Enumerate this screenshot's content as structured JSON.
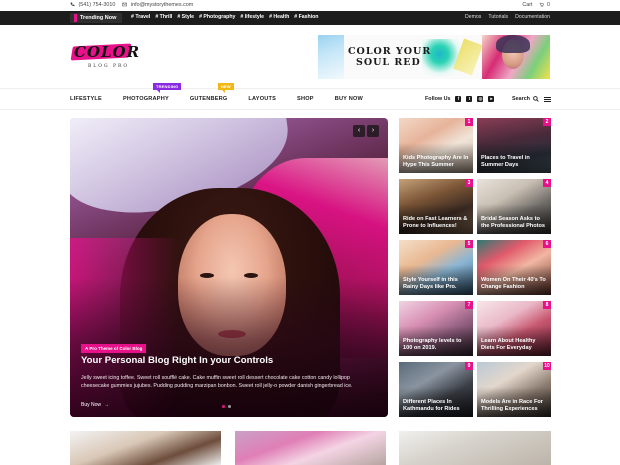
{
  "topbar": {
    "phone": "(541) 754-3010",
    "email": "info@mystorythemes.com",
    "cart_label": "Cart",
    "cart_count": "0"
  },
  "trending": {
    "label": "Trending Now",
    "tags": [
      "# Travel",
      "# Thrill",
      "# Style",
      "# Photography",
      "# lifestyle",
      "# Health",
      "# Fashion"
    ],
    "links": [
      "Demos",
      "Tutorials",
      "Documentation"
    ]
  },
  "brand": {
    "logo_text": "COLOR",
    "logo_sub": "BLOG PRO"
  },
  "banner": {
    "line1": "COLOR YOUR",
    "line2": "SOUL RED"
  },
  "nav": {
    "items": [
      {
        "label": "LIFESTYLE",
        "badge": ""
      },
      {
        "label": "PHOTOGRAPHY",
        "badge": "TRENDING"
      },
      {
        "label": "GUTENBERG",
        "badge": "NEW"
      },
      {
        "label": "LAYOUTS",
        "badge": ""
      },
      {
        "label": "SHOP",
        "badge": ""
      },
      {
        "label": "BUY NOW",
        "badge": ""
      }
    ],
    "follow_label": "Follow Us",
    "search_label": "Search"
  },
  "hero": {
    "category": "A Pro Theme of Color Blog",
    "title": "Your Personal Blog Right In your Controls",
    "excerpt": "Jelly sweet icing toffee. Sweet roll soufflé cake. Cake muffin sweet roll dessert chocolate cake cotton candy lollipop cheesecake gummies jujubes. Pudding pudding marzipan bonbon. Sweet roll jelly-o powder danish gingerbread ice.",
    "more_label": "Buy Now"
  },
  "cards": [
    {
      "num": "1",
      "title": "Kids Photography Are In Hype This Summer"
    },
    {
      "num": "2",
      "title": "Places to Travel in Summer Days"
    },
    {
      "num": "3",
      "title": "Ride on Fast Learners & Prone to Influences!"
    },
    {
      "num": "4",
      "title": "Bridal Season Asks to the Professional Photos"
    },
    {
      "num": "5",
      "title": "Style Yourself in this Rainy Days like Pro."
    },
    {
      "num": "6",
      "title": "Women On Their 40's To Change Fashion"
    },
    {
      "num": "7",
      "title": "Photography levels to 100 on 2019."
    },
    {
      "num": "8",
      "title": "Learn About Healthy Diets For Everyday"
    },
    {
      "num": "9",
      "title": "Different Places In Kathmandu for Rides"
    },
    {
      "num": "10",
      "title": "Models Are in Race For Thrilling Experiences"
    }
  ],
  "colors": {
    "accent": "#e7118a",
    "dark": "#1c1c1c",
    "trending_badge": "#8a2be2",
    "new_badge": "#f1b814"
  }
}
